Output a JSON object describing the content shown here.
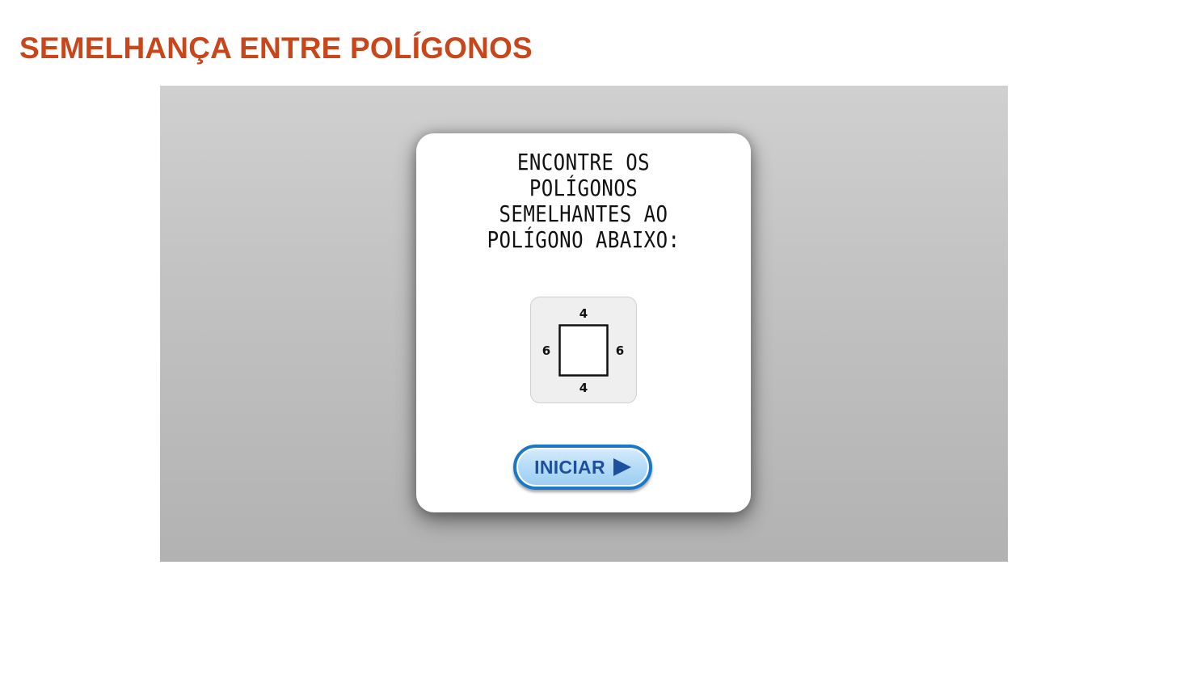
{
  "page": {
    "title": "SEMELHANÇA ENTRE POLÍGONOS"
  },
  "game": {
    "instruction": "ENCONTRE OS\nPOLÍGONOS\nSEMELHANTES AO\nPOLÍGONO ABAIXO:",
    "reference_polygon": {
      "shape": "rectangle",
      "top_side": "4",
      "bottom_side": "4",
      "left_side": "6",
      "right_side": "6"
    },
    "start_button": {
      "label": "INICIAR",
      "icon": "play-arrow-icon"
    }
  },
  "colors": {
    "title": "#c8461a",
    "button_border": "#1a78c8",
    "button_text": "#1e4f9c"
  }
}
